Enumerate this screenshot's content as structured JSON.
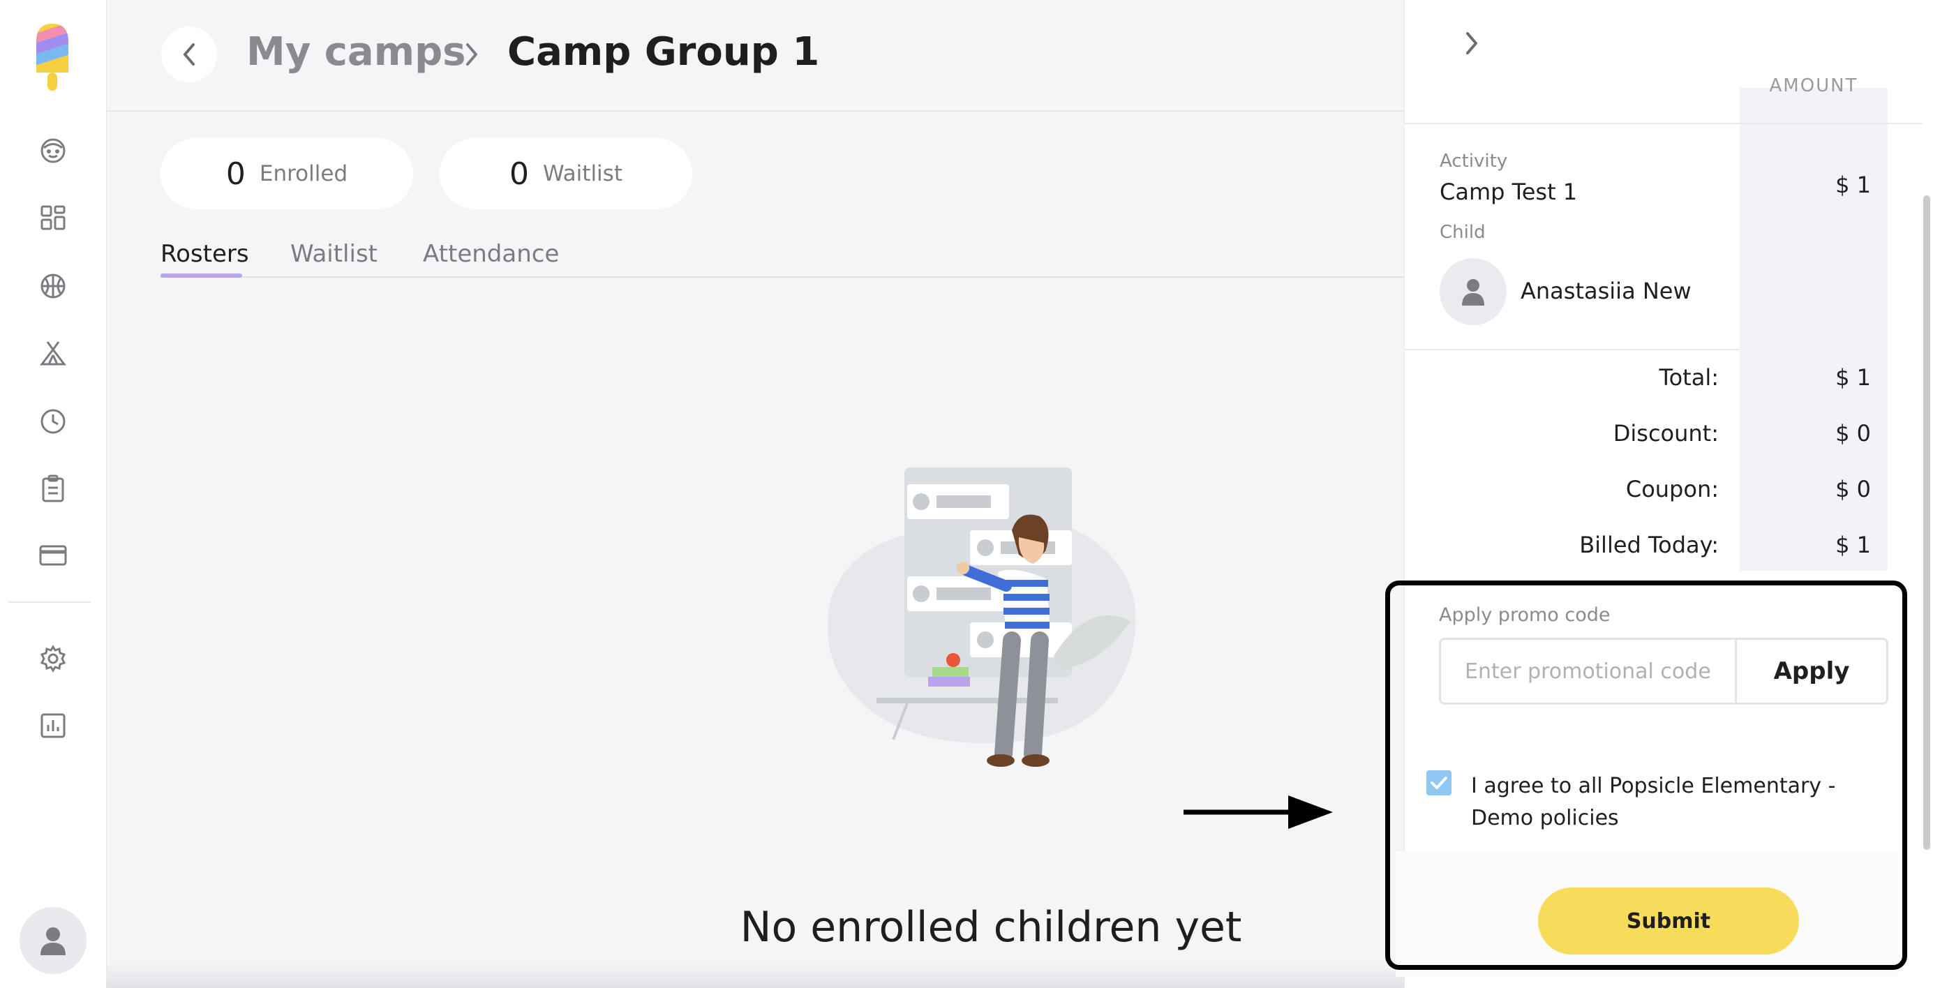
{
  "breadcrumb": {
    "parent": "My camps",
    "current": "Camp Group 1"
  },
  "stats": [
    {
      "value": "0",
      "label": "Enrolled"
    },
    {
      "value": "0",
      "label": "Waitlist"
    }
  ],
  "tabs": [
    {
      "label": "Rosters",
      "active": true
    },
    {
      "label": "Waitlist",
      "active": false
    },
    {
      "label": "Attendance",
      "active": false
    }
  ],
  "empty_state": {
    "message": "No enrolled children yet"
  },
  "sidebar": {
    "items": [
      {
        "icon": "child-face-icon"
      },
      {
        "icon": "dashboard-icon"
      },
      {
        "icon": "activities-ball-icon"
      },
      {
        "icon": "camp-tent-icon"
      },
      {
        "icon": "clock-icon"
      },
      {
        "icon": "clipboard-icon"
      },
      {
        "icon": "credit-card-icon"
      },
      {
        "icon": "gear-icon"
      },
      {
        "icon": "reports-chart-icon"
      }
    ],
    "bottom_icon": "user-avatar-icon"
  },
  "checkout": {
    "amount_header": "AMOUNT",
    "activity_label": "Activity",
    "activity_name": "Camp Test 1",
    "activity_amount": "$ 1",
    "child_label": "Child",
    "child_name": "Anastasiia New",
    "summary": [
      {
        "label": "Total:",
        "value": "$ 1"
      },
      {
        "label": "Discount:",
        "value": "$ 0"
      },
      {
        "label": "Coupon:",
        "value": "$ 0"
      },
      {
        "label": "Billed Today:",
        "value": "$ 1"
      }
    ],
    "promo_label": "Apply promo code",
    "promo_placeholder": "Enter promotional code",
    "promo_value": "",
    "apply_label": "Apply",
    "agree_checked": true,
    "agree_text": "I agree to all Popsicle Elementary - Demo policies",
    "submit_label": "Submit"
  },
  "colors": {
    "accent_underline": "#b9a4ec",
    "submit_button": "#f6dc5a",
    "checkbox": "#8ec7f2",
    "highlight_border": "#000000"
  }
}
